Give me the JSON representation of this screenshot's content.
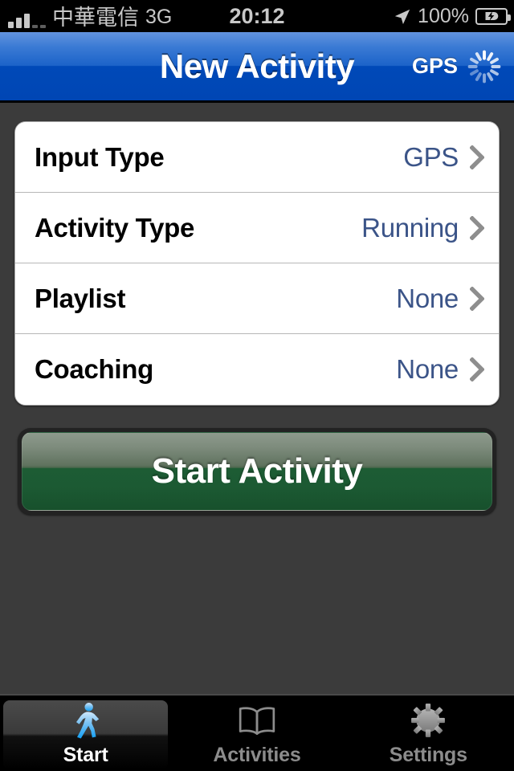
{
  "status_bar": {
    "signal_icon": "signal-bars-icon",
    "carrier": "中華電信",
    "network": "3G",
    "time": "20:12",
    "location_icon": "location-arrow-icon",
    "battery_percent": "100%",
    "battery_icon": "battery-charging-icon"
  },
  "nav_bar": {
    "title": "New Activity",
    "gps_label": "GPS",
    "spinner_icon": "activity-spinner-icon"
  },
  "settings_group": {
    "rows": [
      {
        "label": "Input Type",
        "value": "GPS",
        "chevron_icon": "chevron-right-icon"
      },
      {
        "label": "Activity Type",
        "value": "Running",
        "chevron_icon": "chevron-right-icon"
      },
      {
        "label": "Playlist",
        "value": "None",
        "chevron_icon": "chevron-right-icon"
      },
      {
        "label": "Coaching",
        "value": "None",
        "chevron_icon": "chevron-right-icon"
      }
    ]
  },
  "primary_action": {
    "label": "Start Activity"
  },
  "tab_bar": {
    "tabs": [
      {
        "label": "Start",
        "icon": "runner-icon",
        "active": true
      },
      {
        "label": "Activities",
        "icon": "book-icon",
        "active": false
      },
      {
        "label": "Settings",
        "icon": "gear-icon",
        "active": false
      }
    ]
  },
  "colors": {
    "nav_blue_top": "#6293de",
    "nav_blue_bottom": "#0049b8",
    "value_blue": "#3b5488",
    "button_green": "#1d5c34",
    "background": "#3b3b3b",
    "active_tab_blue": "#3cb0f0"
  }
}
